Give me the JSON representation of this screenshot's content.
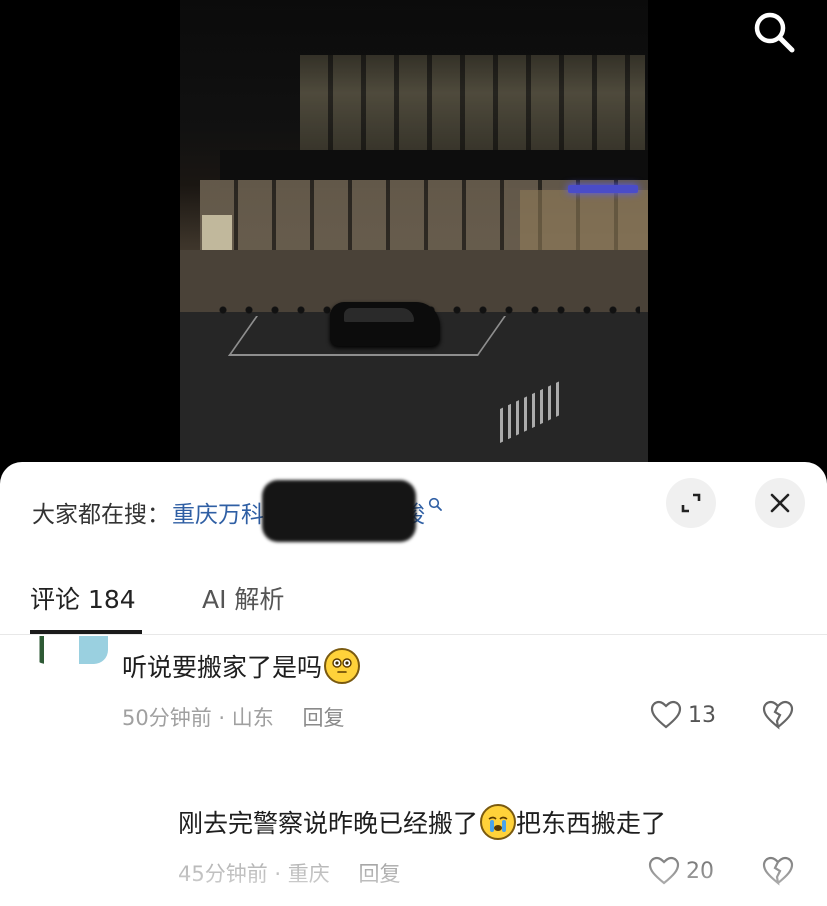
{
  "video": {
    "search_icon": "search-icon"
  },
  "comment_sheet": {
    "search_prefix": "大家都在搜：",
    "search_query": "重庆万科翡翠谷时代峰峻",
    "search_suffix_icon": "search-small-icon",
    "expand_icon": "expand-icon",
    "close_icon": "close-icon",
    "tabs": [
      {
        "label": "评论 184",
        "active": true
      },
      {
        "label": "AI 解析",
        "active": false
      }
    ],
    "comments": [
      {
        "text": "听说要搬家了是吗",
        "emoji": "😳",
        "time": "50分钟前",
        "location": "山东",
        "reply_label": "回复",
        "likes": "13"
      },
      {
        "text_before": "刚去完警察说昨晚已经搬了",
        "emoji": "😭",
        "text_after": "把东西搬走了",
        "time": "45分钟前",
        "location": "重庆",
        "reply_label": "回复",
        "likes": "20"
      }
    ]
  },
  "colors": {
    "link_blue": "#2f5fa4",
    "meta_gray": "#a0a0a0",
    "sheet_bg": "#ffffff"
  }
}
